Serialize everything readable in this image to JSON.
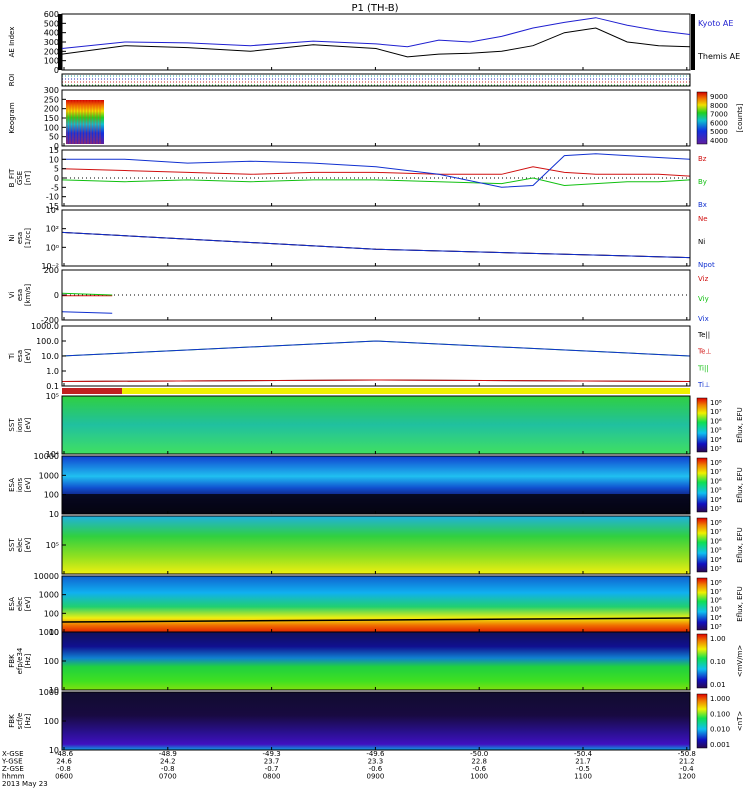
{
  "title": "P1 (TH-B)",
  "colors": {
    "kyoto": "#1f1fd0",
    "themis": "#000000",
    "bz": "#d01010",
    "by": "#10c010",
    "bx": "#1030d0",
    "roi_bar": "#c02020",
    "roi_yellow": "#f0f000"
  },
  "chart_data": [
    {
      "type": "line",
      "panel": "ae",
      "ylabel": "AE Index",
      "ylim": [
        0,
        600
      ],
      "yticks": [
        "600",
        "500",
        "400",
        "300",
        "200",
        "100",
        "0"
      ],
      "series": [
        {
          "name": "Kyoto AE",
          "x": [
            0,
            0.1,
            0.2,
            0.3,
            0.4,
            0.5,
            0.55,
            0.6,
            0.65,
            0.7,
            0.75,
            0.8,
            0.85,
            0.9,
            0.95,
            1.0
          ],
          "values": [
            230,
            300,
            290,
            260,
            310,
            280,
            250,
            320,
            300,
            360,
            450,
            510,
            560,
            480,
            420,
            380
          ]
        },
        {
          "name": "Themis AE",
          "x": [
            0,
            0.1,
            0.2,
            0.3,
            0.4,
            0.5,
            0.55,
            0.6,
            0.65,
            0.7,
            0.75,
            0.8,
            0.85,
            0.9,
            0.95,
            1.0
          ],
          "values": [
            170,
            260,
            240,
            200,
            270,
            230,
            140,
            170,
            180,
            200,
            260,
            400,
            450,
            300,
            260,
            250
          ]
        }
      ]
    },
    {
      "type": "heatmap",
      "panel": "roi",
      "ylabel": "ROI"
    },
    {
      "type": "heatmap",
      "panel": "keogram",
      "ylabel": "Keogram",
      "yticks": [
        "300",
        "250",
        "200",
        "150",
        "100",
        "50",
        "0"
      ],
      "colorbar": {
        "label": "[counts]",
        "ticks": [
          "9000",
          "8000",
          "7000",
          "6000",
          "5000",
          "4000"
        ]
      }
    },
    {
      "type": "line",
      "panel": "bfield",
      "ylabel": "B_FIT\nGSE\n[nT]",
      "ylim": [
        -15,
        15
      ],
      "yticks": [
        "15",
        "10",
        "5",
        "0",
        "-5",
        "-10",
        "-15"
      ],
      "series": [
        {
          "name": "Bz",
          "x": [
            0,
            0.1,
            0.2,
            0.3,
            0.4,
            0.5,
            0.6,
            0.7,
            0.75,
            0.8,
            0.85,
            0.9,
            0.95,
            1.0
          ],
          "values": [
            5,
            4,
            3,
            2,
            3,
            3,
            2,
            2,
            6,
            3,
            2,
            2,
            2,
            1
          ]
        },
        {
          "name": "By",
          "x": [
            0,
            0.1,
            0.2,
            0.3,
            0.4,
            0.5,
            0.6,
            0.7,
            0.75,
            0.8,
            0.85,
            0.9,
            0.95,
            1.0
          ],
          "values": [
            -1,
            -2,
            -1,
            -2,
            -1,
            -1,
            -2,
            -3,
            0,
            -4,
            -3,
            -2,
            -2,
            -1
          ]
        },
        {
          "name": "Bx",
          "x": [
            0,
            0.1,
            0.2,
            0.3,
            0.4,
            0.5,
            0.6,
            0.7,
            0.75,
            0.8,
            0.85,
            0.9,
            0.95,
            1.0
          ],
          "values": [
            10,
            10,
            8,
            9,
            8,
            6,
            2,
            -5,
            -4,
            12,
            13,
            12,
            11,
            10
          ]
        }
      ]
    },
    {
      "type": "line",
      "panel": "density",
      "ylabel": "Ni\nesa\n[1/cc]",
      "yticks": [
        "10⁴",
        "10²",
        "10⁰",
        "10⁻²"
      ],
      "series": [
        {
          "name": "Ne",
          "x": [
            0,
            0.5,
            1.0
          ],
          "values": [
            0.6,
            0.3,
            0.15
          ]
        },
        {
          "name": "Ni",
          "x": [
            0,
            0.5,
            1.0
          ],
          "values": [
            0.6,
            0.3,
            0.15
          ]
        },
        {
          "name": "Npot",
          "x": [
            0,
            0.5,
            1.0
          ],
          "values": [
            0.6,
            0.3,
            0.15
          ]
        }
      ]
    },
    {
      "type": "line",
      "panel": "velocity",
      "ylabel": "Vi\nesa\n[km/s]",
      "yticks": [
        "200",
        "0",
        "-200"
      ],
      "series": [
        {
          "name": "Viz",
          "x": [
            0,
            0.08
          ],
          "values": [
            -10,
            -10
          ]
        },
        {
          "name": "Viy",
          "x": [
            0,
            0.08
          ],
          "values": [
            20,
            0
          ]
        },
        {
          "name": "Vix",
          "x": [
            0,
            0.08
          ],
          "values": [
            -200,
            -220
          ]
        }
      ]
    },
    {
      "type": "line",
      "panel": "temp",
      "ylabel": "Ti\nesa\n[eV]",
      "yticks": [
        "1000.0",
        "100.0",
        "10.0",
        "1.0",
        "0.1"
      ],
      "series": [
        {
          "name": "Te||",
          "x": [
            0,
            0.5,
            1.0
          ],
          "values": [
            300,
            400,
            300
          ]
        },
        {
          "name": "Te⊥",
          "x": [
            0,
            0.5,
            1.0
          ],
          "values": [
            300,
            400,
            300
          ]
        },
        {
          "name": "Ti||",
          "x": [
            0,
            0.5,
            1.0
          ],
          "values": [
            2000,
            3000,
            2000
          ]
        },
        {
          "name": "Ti⊥",
          "x": [
            0,
            0.5,
            1.0
          ],
          "values": [
            2000,
            3000,
            2000
          ]
        }
      ]
    },
    {
      "type": "heatmap",
      "panel": "sst_i",
      "ylabel": "SST\nions\n[eV]",
      "yticks": [
        "10⁵",
        "10⁴"
      ],
      "colorbar": {
        "label": "Eflux, EFU",
        "ticks": [
          "10⁸",
          "10⁷",
          "10⁶",
          "10⁵",
          "10⁴",
          "10³"
        ]
      }
    },
    {
      "type": "heatmap",
      "panel": "esa_i",
      "ylabel": "ESA\nions\n[eV]",
      "yticks": [
        "10000",
        "1000",
        "100",
        "10"
      ],
      "colorbar": {
        "label": "Eflux, EFU",
        "ticks": [
          "10⁸",
          "10⁷",
          "10⁶",
          "10⁵",
          "10⁴",
          "10³"
        ]
      }
    },
    {
      "type": "heatmap",
      "panel": "sst_e",
      "ylabel": "SST\nelec\n[eV]",
      "yticks": [
        "10⁵"
      ],
      "colorbar": {
        "label": "Eflux, EFU",
        "ticks": [
          "10⁸",
          "10⁷",
          "10⁶",
          "10⁵",
          "10⁴",
          "10³"
        ]
      }
    },
    {
      "type": "heatmap",
      "panel": "esa_e",
      "ylabel": "ESA\nelec\n[eV]",
      "yticks": [
        "10000",
        "1000",
        "100",
        "10"
      ],
      "colorbar": {
        "label": "Eflux, EFU",
        "ticks": [
          "10⁸",
          "10⁷",
          "10⁶",
          "10⁵",
          "10⁴",
          "10³"
        ]
      }
    },
    {
      "type": "heatmap",
      "panel": "fbk_e",
      "ylabel": "FBK\nefp/e34\n[Hz]",
      "yticks": [
        "1000",
        "100",
        "10"
      ],
      "colorbar": {
        "label": "<mV/m>",
        "ticks": [
          "1.00",
          "0.10",
          "0.01"
        ]
      }
    },
    {
      "type": "heatmap",
      "panel": "fbk_b",
      "ylabel": "FBK\nscf/e\n[Hz]",
      "yticks": [
        "1000",
        "100",
        "10"
      ],
      "colorbar": {
        "label": "<nT>",
        "ticks": [
          "1.000",
          "0.100",
          "0.010",
          "0.001"
        ]
      }
    }
  ],
  "xaxis": {
    "row_labels": [
      "X-GSE",
      "Y-GSE",
      "Z-GSE",
      "hhmm",
      "2013 May 23"
    ],
    "ticks": [
      {
        "x": "-48.6",
        "y": "24.6",
        "z": "-0.8",
        "t": "0600"
      },
      {
        "x": "-48.9",
        "y": "24.2",
        "z": "-0.8",
        "t": "0700"
      },
      {
        "x": "-49.3",
        "y": "23.7",
        "z": "-0.7",
        "t": "0800"
      },
      {
        "x": "-49.6",
        "y": "23.3",
        "z": "-0.6",
        "t": "0900"
      },
      {
        "x": "-50.0",
        "y": "22.8",
        "z": "-0.6",
        "t": "1000"
      },
      {
        "x": "-50.4",
        "y": "21.7",
        "z": "-0.5",
        "t": "1100"
      },
      {
        "x": "-50.8",
        "y": "21.2",
        "z": "-0.4",
        "t": "1200"
      }
    ]
  }
}
